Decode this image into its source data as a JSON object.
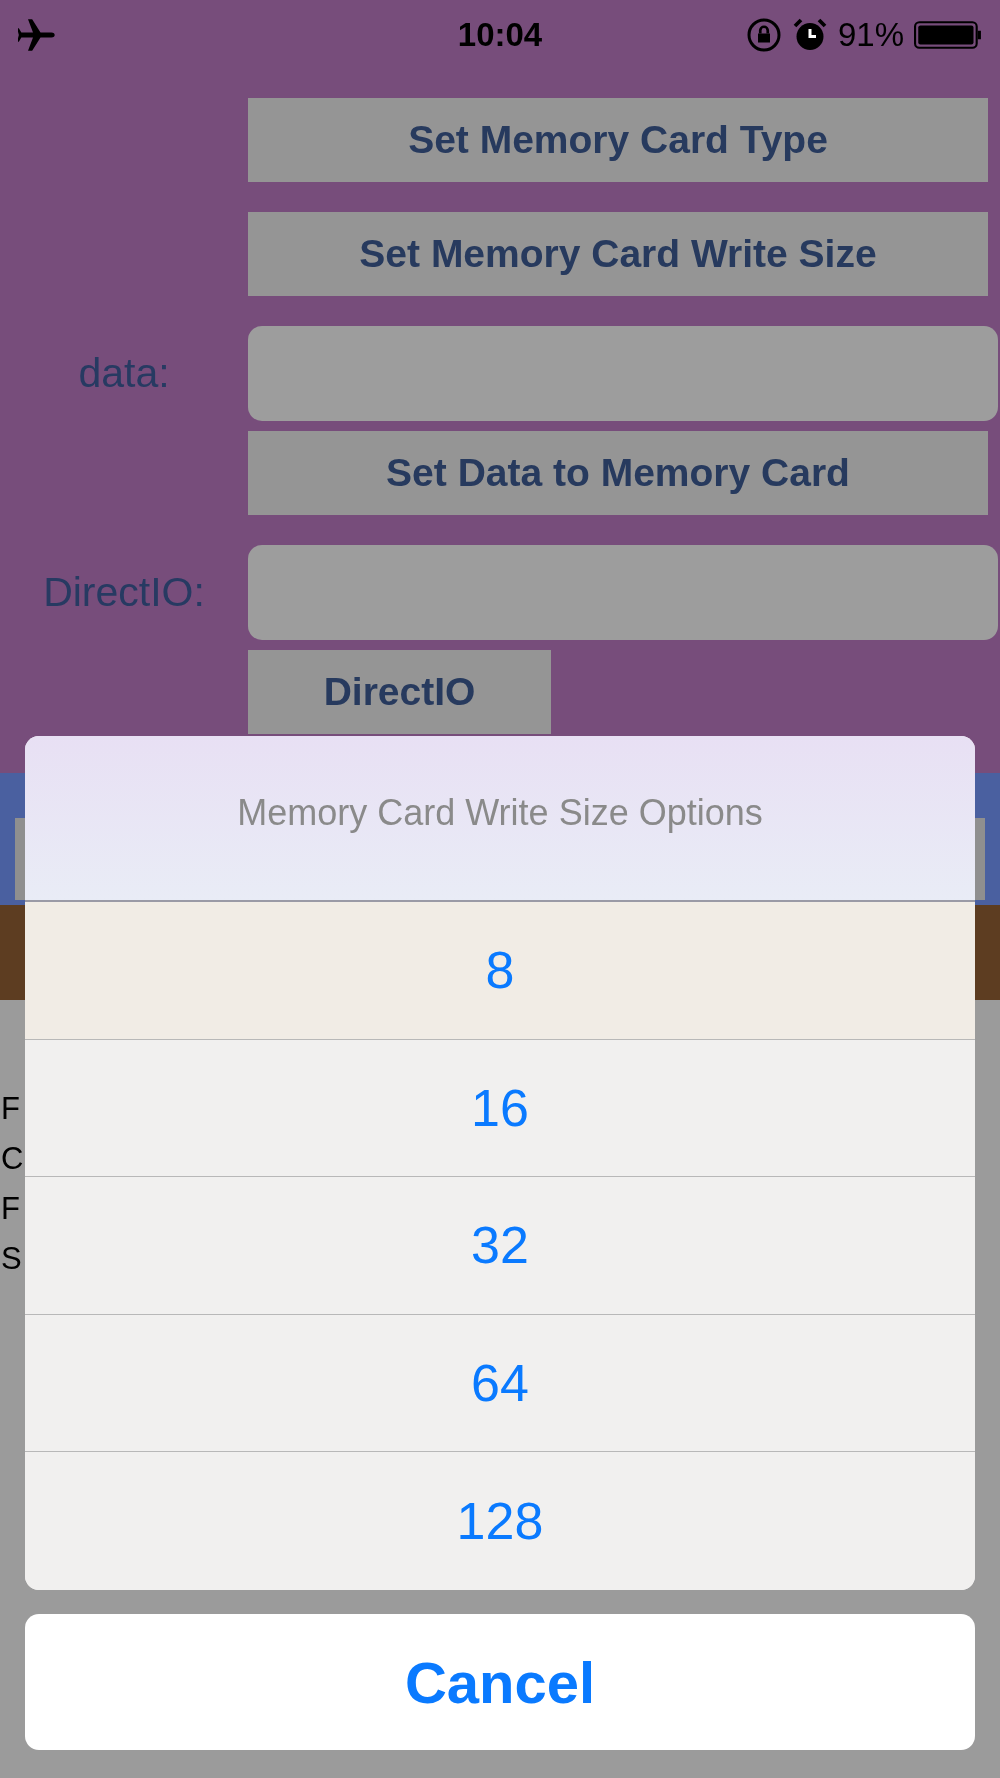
{
  "status_bar": {
    "time": "10:04",
    "battery": "91%"
  },
  "buttons_top": [
    "Set Memory Card Type",
    "Set Memory Card Write Size"
  ],
  "data_field": {
    "label": "data:"
  },
  "set_data_button": "Set Data to Memory Card",
  "directio_field": {
    "label": "DirectIO:"
  },
  "directio_button": "DirectIO",
  "log_lines": [
    "F",
    "C",
    "F",
    "S"
  ],
  "action_sheet": {
    "title": "Memory Card Write Size Options",
    "options": [
      "8",
      "16",
      "32",
      "64",
      "128"
    ],
    "cancel": "Cancel"
  }
}
